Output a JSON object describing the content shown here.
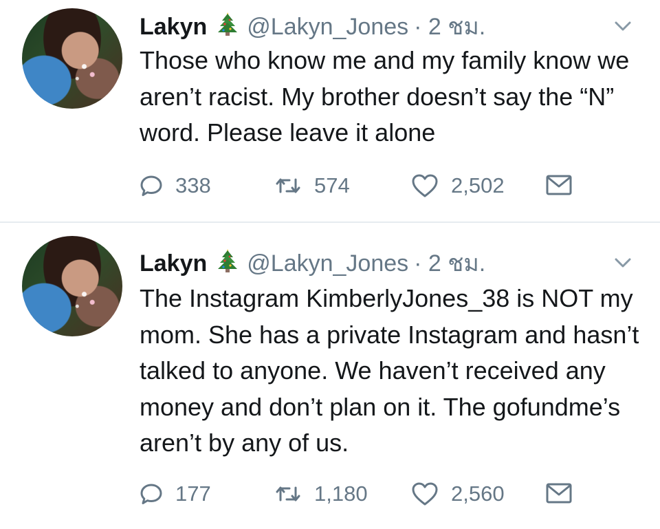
{
  "tweets": [
    {
      "name": "Lakyn",
      "badge_icon": "christmas-tree-icon",
      "handle": "@Lakyn_Jones",
      "time": "· 2 ชม.",
      "text": "Those who know me and my family know we aren’t racist. My brother doesn’t say the “N” word. Please leave it alone",
      "replies": "338",
      "retweets": "574",
      "likes": "2,502"
    },
    {
      "name": "Lakyn",
      "badge_icon": "christmas-tree-icon",
      "handle": "@Lakyn_Jones",
      "time": "· 2 ชม.",
      "text": "The Instagram KimberlyJones_38 is NOT my mom. She has a private Instagram and hasn’t talked to anyone. We haven’t received any money and don’t plan on it. The gofundme’s aren’t by any of us.",
      "replies": "177",
      "retweets": "1,180",
      "likes": "2,560"
    }
  ],
  "colors": {
    "text": "#14171a",
    "secondary": "#657786",
    "divider": "#e6ecf0"
  }
}
